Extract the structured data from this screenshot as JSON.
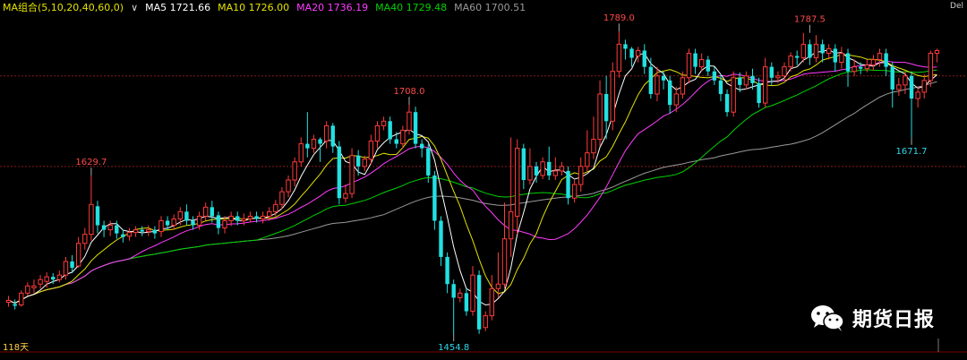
{
  "header": {
    "indicator_name": "MA组合(5,10,20,40,60,0)",
    "ma5": "MA5 1721.66",
    "ma10": "MA10 1726.00",
    "ma20": "MA20 1736.19",
    "ma40": "MA40 1729.48",
    "ma60": "MA60 1700.51",
    "timeframe": "Del"
  },
  "footer": {
    "bar_count": "118天"
  },
  "watermark": {
    "text": "期货日报",
    "icon": "wechat-icon"
  },
  "colors": {
    "up": "#ff3b3b",
    "down": "#22e1e1",
    "ma5": "#ffffff",
    "ma10": "#e3e300",
    "ma20": "#ff3cff",
    "ma40": "#00d100",
    "ma60": "#9a9a9a",
    "grid": "#8a1a1a"
  },
  "chart_data": {
    "type": "candlestick",
    "ylim": [
      1440,
      1810
    ],
    "reference_levels": [
      1740,
      1640
    ],
    "annotations": [
      {
        "label": "1629.7",
        "bar": 13,
        "value": 1629.7,
        "position": "above"
      },
      {
        "label": "1708.0",
        "bar": 63,
        "value": 1708.0,
        "position": "above"
      },
      {
        "label": "1454.8",
        "bar": 70,
        "value": 1454.8,
        "position": "below"
      },
      {
        "label": "1789.0",
        "bar": 96,
        "value": 1789.0,
        "position": "above"
      },
      {
        "label": "1787.5",
        "bar": 126,
        "value": 1787.5,
        "position": "above"
      },
      {
        "label": "1671.7",
        "bar": 142,
        "value": 1671.7,
        "position": "below"
      }
    ],
    "candles": [
      [
        1490,
        1492,
        1485,
        1497
      ],
      [
        1488,
        1486,
        1482,
        1493
      ],
      [
        1487,
        1500,
        1485,
        1503
      ],
      [
        1500,
        1508,
        1497,
        1512
      ],
      [
        1506,
        1508,
        1500,
        1515
      ],
      [
        1510,
        1515,
        1505,
        1520
      ],
      [
        1513,
        1518,
        1506,
        1523
      ],
      [
        1518,
        1515,
        1510,
        1522
      ],
      [
        1515,
        1520,
        1512,
        1525
      ],
      [
        1520,
        1535,
        1515,
        1540
      ],
      [
        1535,
        1528,
        1522,
        1542
      ],
      [
        1530,
        1555,
        1528,
        1562
      ],
      [
        1555,
        1565,
        1548,
        1572
      ],
      [
        1565,
        1598,
        1558,
        1629.7
      ],
      [
        1596,
        1575,
        1566,
        1602
      ],
      [
        1575,
        1570,
        1562,
        1580
      ],
      [
        1570,
        1575,
        1563,
        1580
      ],
      [
        1575,
        1566,
        1560,
        1580
      ],
      [
        1565,
        1562,
        1556,
        1570
      ],
      [
        1563,
        1567,
        1558,
        1572
      ],
      [
        1567,
        1570,
        1562,
        1574
      ],
      [
        1570,
        1568,
        1563,
        1574
      ],
      [
        1568,
        1570,
        1563,
        1575
      ],
      [
        1570,
        1566,
        1560,
        1574
      ],
      [
        1568,
        1580,
        1562,
        1585
      ],
      [
        1580,
        1575,
        1570,
        1585
      ],
      [
        1575,
        1582,
        1570,
        1587
      ],
      [
        1582,
        1590,
        1575,
        1595
      ],
      [
        1590,
        1580,
        1575,
        1598
      ],
      [
        1580,
        1575,
        1570,
        1585
      ],
      [
        1575,
        1585,
        1570,
        1590
      ],
      [
        1585,
        1595,
        1580,
        1600
      ],
      [
        1595,
        1585,
        1578,
        1602
      ],
      [
        1586,
        1572,
        1565,
        1590
      ],
      [
        1572,
        1580,
        1566,
        1585
      ],
      [
        1580,
        1585,
        1574,
        1590
      ],
      [
        1585,
        1580,
        1575,
        1590
      ],
      [
        1580,
        1582,
        1575,
        1588
      ],
      [
        1582,
        1585,
        1578,
        1590
      ],
      [
        1585,
        1582,
        1578,
        1590
      ],
      [
        1582,
        1585,
        1577,
        1590
      ],
      [
        1585,
        1590,
        1580,
        1595
      ],
      [
        1590,
        1598,
        1585,
        1603
      ],
      [
        1598,
        1612,
        1593,
        1617
      ],
      [
        1612,
        1625,
        1606,
        1630
      ],
      [
        1625,
        1645,
        1618,
        1650
      ],
      [
        1645,
        1665,
        1640,
        1672
      ],
      [
        1665,
        1660,
        1650,
        1700
      ],
      [
        1660,
        1670,
        1655,
        1675
      ],
      [
        1670,
        1665,
        1645,
        1672
      ],
      [
        1668,
        1685,
        1660,
        1690
      ],
      [
        1685,
        1662,
        1655,
        1688
      ],
      [
        1662,
        1605,
        1598,
        1668
      ],
      [
        1605,
        1610,
        1600,
        1620
      ],
      [
        1610,
        1652,
        1605,
        1660
      ],
      [
        1652,
        1640,
        1630,
        1658
      ],
      [
        1640,
        1648,
        1635,
        1652
      ],
      [
        1648,
        1668,
        1642,
        1675
      ],
      [
        1668,
        1685,
        1660,
        1690
      ],
      [
        1685,
        1690,
        1680,
        1695
      ],
      [
        1690,
        1670,
        1665,
        1695
      ],
      [
        1670,
        1665,
        1660,
        1678
      ],
      [
        1665,
        1680,
        1660,
        1685
      ],
      [
        1680,
        1700,
        1675,
        1708.0
      ],
      [
        1700,
        1665,
        1660,
        1706
      ],
      [
        1665,
        1660,
        1650,
        1670
      ],
      [
        1660,
        1630,
        1622,
        1665
      ],
      [
        1630,
        1580,
        1570,
        1635
      ],
      [
        1580,
        1540,
        1530,
        1585
      ],
      [
        1540,
        1510,
        1500,
        1545
      ],
      [
        1510,
        1495,
        1454.8,
        1515
      ],
      [
        1495,
        1500,
        1490,
        1505
      ],
      [
        1500,
        1480,
        1475,
        1505
      ],
      [
        1480,
        1520,
        1475,
        1530
      ],
      [
        1520,
        1460,
        1455,
        1525
      ],
      [
        1462,
        1475,
        1458,
        1480
      ],
      [
        1475,
        1505,
        1470,
        1520
      ],
      [
        1505,
        1510,
        1495,
        1545
      ],
      [
        1510,
        1560,
        1505,
        1600
      ],
      [
        1560,
        1590,
        1540,
        1672
      ],
      [
        1585,
        1660,
        1565,
        1670
      ],
      [
        1660,
        1625,
        1615,
        1665
      ],
      [
        1625,
        1640,
        1620,
        1660
      ],
      [
        1640,
        1630,
        1622,
        1645
      ],
      [
        1630,
        1645,
        1626,
        1650
      ],
      [
        1645,
        1630,
        1625,
        1662
      ],
      [
        1630,
        1635,
        1625,
        1650
      ],
      [
        1635,
        1640,
        1630,
        1645
      ],
      [
        1635,
        1605,
        1598,
        1640
      ],
      [
        1605,
        1620,
        1600,
        1625
      ],
      [
        1620,
        1640,
        1612,
        1650
      ],
      [
        1640,
        1655,
        1635,
        1680
      ],
      [
        1655,
        1670,
        1648,
        1695
      ],
      [
        1670,
        1720,
        1662,
        1735
      ],
      [
        1720,
        1690,
        1670,
        1740
      ],
      [
        1690,
        1745,
        1680,
        1755
      ],
      [
        1745,
        1775,
        1738,
        1789.0
      ],
      [
        1775,
        1770,
        1758,
        1780
      ],
      [
        1770,
        1760,
        1750,
        1772
      ],
      [
        1762,
        1768,
        1755,
        1772
      ],
      [
        1768,
        1750,
        1742,
        1775
      ],
      [
        1750,
        1720,
        1715,
        1760
      ],
      [
        1720,
        1740,
        1712,
        1750
      ],
      [
        1740,
        1735,
        1725,
        1745
      ],
      [
        1735,
        1708,
        1698,
        1740
      ],
      [
        1708,
        1720,
        1700,
        1728
      ],
      [
        1720,
        1738,
        1715,
        1745
      ],
      [
        1738,
        1765,
        1732,
        1770
      ],
      [
        1765,
        1750,
        1742,
        1770
      ],
      [
        1750,
        1758,
        1745,
        1765
      ],
      [
        1758,
        1745,
        1740,
        1762
      ],
      [
        1745,
        1735,
        1730,
        1750
      ],
      [
        1735,
        1720,
        1712,
        1742
      ],
      [
        1720,
        1700,
        1695,
        1725
      ],
      [
        1700,
        1738,
        1695,
        1745
      ],
      [
        1738,
        1730,
        1722,
        1744
      ],
      [
        1730,
        1740,
        1725,
        1745
      ],
      [
        1740,
        1732,
        1725,
        1748
      ],
      [
        1732,
        1710,
        1705,
        1738
      ],
      [
        1710,
        1750,
        1705,
        1760
      ],
      [
        1750,
        1738,
        1730,
        1755
      ],
      [
        1738,
        1740,
        1732,
        1745
      ],
      [
        1740,
        1750,
        1735,
        1755
      ],
      [
        1750,
        1762,
        1745,
        1766
      ],
      [
        1762,
        1760,
        1752,
        1768
      ],
      [
        1760,
        1775,
        1755,
        1787.5
      ],
      [
        1775,
        1760,
        1752,
        1780
      ],
      [
        1760,
        1775,
        1755,
        1785
      ],
      [
        1775,
        1765,
        1755,
        1780
      ],
      [
        1765,
        1770,
        1758,
        1775
      ],
      [
        1770,
        1755,
        1745,
        1775
      ],
      [
        1755,
        1765,
        1748,
        1772
      ],
      [
        1765,
        1745,
        1728,
        1770
      ],
      [
        1745,
        1750,
        1740,
        1758
      ],
      [
        1750,
        1748,
        1742,
        1755
      ],
      [
        1748,
        1752,
        1744,
        1758
      ],
      [
        1752,
        1758,
        1746,
        1763
      ],
      [
        1758,
        1765,
        1750,
        1770
      ],
      [
        1765,
        1750,
        1740,
        1770
      ],
      [
        1750,
        1725,
        1705,
        1755
      ],
      [
        1725,
        1730,
        1718,
        1738
      ],
      [
        1730,
        1740,
        1720,
        1745
      ],
      [
        1740,
        1715,
        1671.7,
        1745
      ],
      [
        1715,
        1722,
        1705,
        1728
      ],
      [
        1722,
        1735,
        1715,
        1742
      ],
      [
        1735,
        1765,
        1728,
        1768
      ],
      [
        1765,
        1768,
        1755,
        1770
      ]
    ]
  }
}
